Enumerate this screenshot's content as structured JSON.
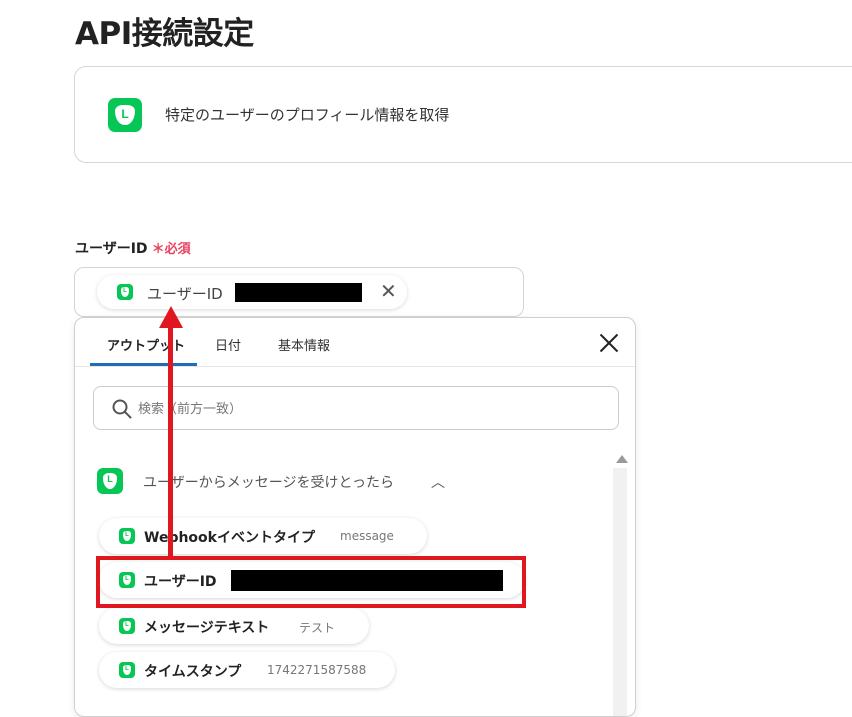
{
  "page": {
    "title": "API接続設定"
  },
  "action_card": {
    "text": "特定のユーザーのプロフィール情報を取得"
  },
  "field": {
    "label": "ユーザーID",
    "required": "＊必須",
    "chip_label": "ユーザーID",
    "chip_close": "✕"
  },
  "dropdown": {
    "tabs": [
      {
        "label": "アウトプット"
      },
      {
        "label": "日付"
      },
      {
        "label": "基本情報"
      }
    ],
    "search": {
      "placeholder": "検索（前方一致）",
      "value": ""
    },
    "group": {
      "label": "ユーザーからメッセージを受けとったら",
      "chevron": "︿"
    },
    "items": [
      {
        "label": "Webhookイベントタイプ",
        "value": "message"
      },
      {
        "label": "ユーザーID",
        "value": ""
      },
      {
        "label": "メッセージテキスト",
        "value": "テスト"
      },
      {
        "label": "タイムスタンプ",
        "value": "1742271587588"
      }
    ]
  },
  "colors": {
    "line_green": "#06c755",
    "annotation_red": "#e0171f",
    "required_red": "#e8435f",
    "tab_underline": "#1f6eb5"
  },
  "icons": [
    "line-icon",
    "close-icon",
    "search-icon",
    "chevron-up-icon"
  ]
}
